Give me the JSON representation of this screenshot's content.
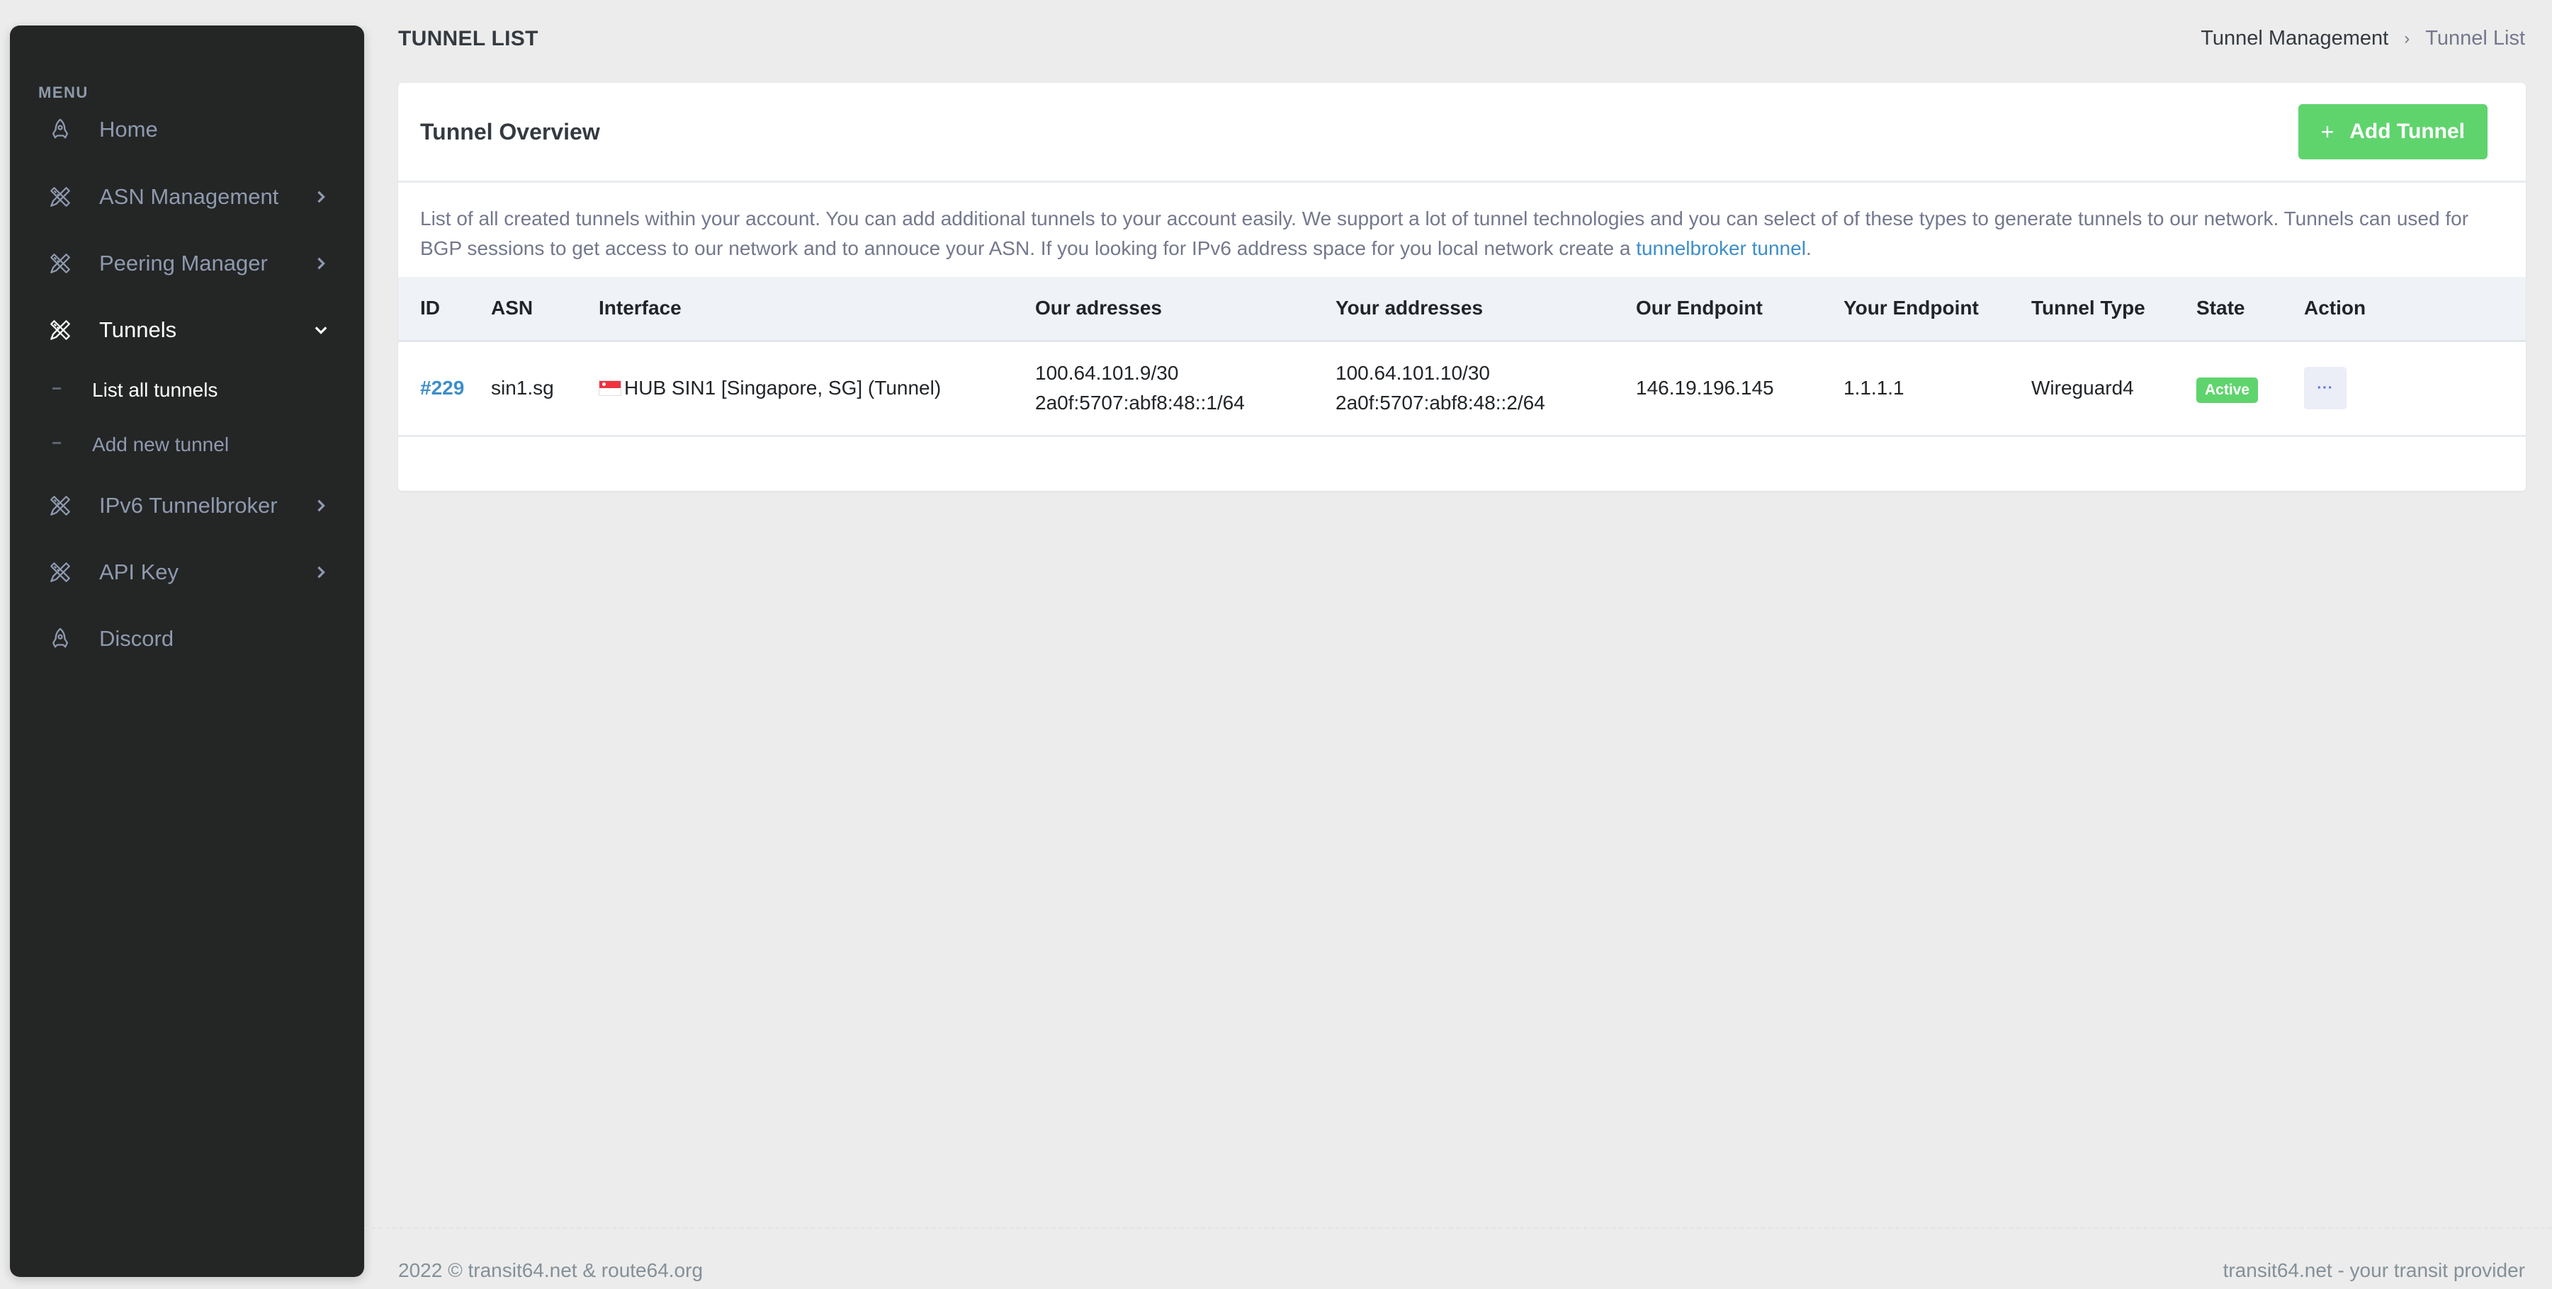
{
  "sidebar": {
    "menu_title": "MENU",
    "items": [
      {
        "label": "Home",
        "icon": "rocket-icon",
        "chevron": false,
        "active": false
      },
      {
        "label": "ASN Management",
        "icon": "tools-icon",
        "chevron": "right",
        "active": false
      },
      {
        "label": "Peering Manager",
        "icon": "tools-icon",
        "chevron": "right",
        "active": false
      },
      {
        "label": "Tunnels",
        "icon": "tools-icon",
        "chevron": "down",
        "active": true
      },
      {
        "label": "IPv6 Tunnelbroker",
        "icon": "tools-icon",
        "chevron": "right",
        "active": false
      },
      {
        "label": "API Key",
        "icon": "tools-icon",
        "chevron": "right",
        "active": false
      },
      {
        "label": "Discord",
        "icon": "rocket-icon",
        "chevron": false,
        "active": false
      }
    ],
    "tunnels_submenu": [
      {
        "label": "List all tunnels",
        "active": true
      },
      {
        "label": "Add new tunnel",
        "active": false
      }
    ]
  },
  "header": {
    "title": "TUNNEL LIST",
    "breadcrumb": {
      "parent": "Tunnel Management",
      "current": "Tunnel List"
    }
  },
  "card": {
    "title": "Tunnel Overview",
    "add_button_label": "Add Tunnel",
    "description": "List of all created tunnels within your account. You can add additional tunnels to your account easily. We support a lot of tunnel technologies and you can select of of these types to generate tunnels to our network. Tunnels can used for BGP sessions to get access to our network and to annouce your ASN. If you looking for IPv6 address space for you local network create a ",
    "description_link": "tunnelbroker tunnel",
    "description_end": "."
  },
  "table": {
    "columns": [
      "ID",
      "ASN",
      "Interface",
      "Our adresses",
      "Your addresses",
      "Our Endpoint",
      "Your Endpoint",
      "Tunnel Type",
      "State",
      "Action"
    ],
    "rows": [
      {
        "id": "#229",
        "asn": "sin1.sg",
        "interface": "HUB SIN1 [Singapore, SG] (Tunnel)",
        "interface_flag": "SG",
        "our_addr_v4": "100.64.101.9/30",
        "our_addr_v6": "2a0f:5707:abf8:48::1/64",
        "your_addr_v4": "100.64.101.10/30",
        "your_addr_v6": "2a0f:5707:abf8:48::2/64",
        "our_endpoint": "146.19.196.145",
        "your_endpoint": "1.1.1.1",
        "tunnel_type": "Wireguard4",
        "state": "Active",
        "action_label": "···"
      }
    ]
  },
  "footer": {
    "left": "2022 © transit64.net & route64.org",
    "right": "transit64.net - your transit provider"
  },
  "colors": {
    "accent_green": "#5fd46d",
    "link_blue": "#3d8ec9",
    "sidebar_bg": "#242525",
    "page_bg": "#ececec"
  }
}
